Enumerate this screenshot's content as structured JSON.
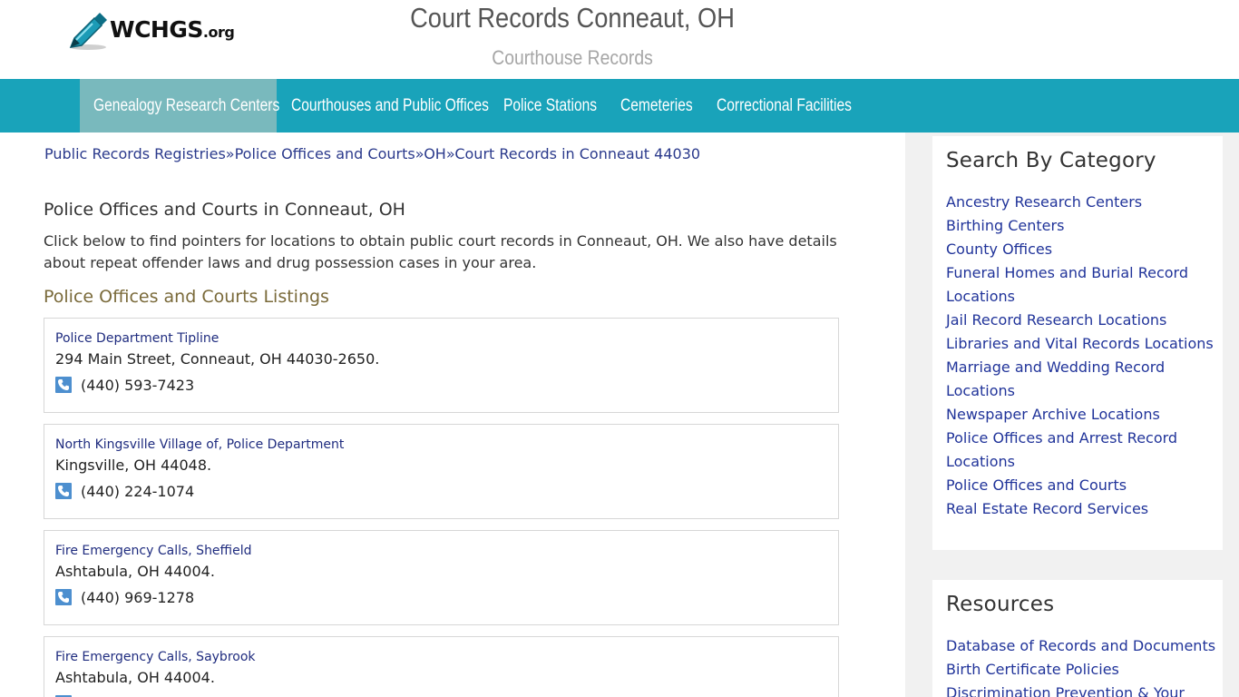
{
  "header": {
    "logo_text": "WCHGS",
    "logo_suffix": ".org",
    "title": "Court Records Conneaut, OH",
    "subtitle": "Courthouse Records"
  },
  "nav": {
    "items": [
      {
        "label": "Genealogy Research Centers",
        "active": true
      },
      {
        "label": "Courthouses and Public Offices",
        "active": false
      },
      {
        "label": "Police Stations",
        "active": false
      },
      {
        "label": "Cemeteries",
        "active": false
      },
      {
        "label": "Correctional Facilities",
        "active": false
      }
    ]
  },
  "breadcrumb": {
    "items": [
      "Public Records Registries",
      "Police Offices and Courts",
      "OH",
      "Court Records in Conneaut 44030"
    ],
    "separator": "»"
  },
  "main": {
    "heading": "Police Offices and Courts in Conneaut, OH",
    "intro": "Click below to find pointers for locations to obtain public court records in Conneaut, OH. We also have details about repeat offender laws and drug possession cases in your area.",
    "listing_heading": "Police Offices and Courts Listings",
    "listings": [
      {
        "name": "Police Department Tipline",
        "address": "294 Main Street, Conneaut, OH 44030-2650.",
        "phone": "(440) 593-7423"
      },
      {
        "name": "North Kingsville Village of, Police Department",
        "address": "Kingsville, OH 44048.",
        "phone": "(440) 224-1074"
      },
      {
        "name": "Fire Emergency Calls, Sheffield",
        "address": "Ashtabula, OH 44004.",
        "phone": "(440) 969-1278"
      },
      {
        "name": "Fire Emergency Calls, Saybrook",
        "address": "Ashtabula, OH 44004.",
        "phone": ""
      }
    ]
  },
  "sidebar": {
    "category_title": "Search By Category",
    "categories": [
      "Ancestry Research Centers",
      "Birthing Centers",
      "County Offices",
      "Funeral Homes and Burial Record",
      "Locations",
      "Jail Record Research Locations",
      "Libraries and Vital Records Locations",
      "Marriage and Wedding Record",
      "Locations",
      "Newspaper Archive Locations",
      "Police Offices and Arrest Record",
      "Locations",
      "Police Offices and Courts",
      "Real Estate Record Services"
    ],
    "resources_title": "Resources",
    "resources": [
      "Database of Records and Documents",
      "Birth Certificate Policies",
      "Discrimination Prevention & Your"
    ]
  },
  "colors": {
    "nav_bg": "#19a3ba",
    "nav_active_bg": "#79b9bd",
    "link": "#21349a",
    "listing_heading": "#7a6a3a",
    "phone_icon": "#4d8fcf"
  },
  "icons": {
    "logo": "pen-nib-icon",
    "phone": "phone-icon"
  }
}
